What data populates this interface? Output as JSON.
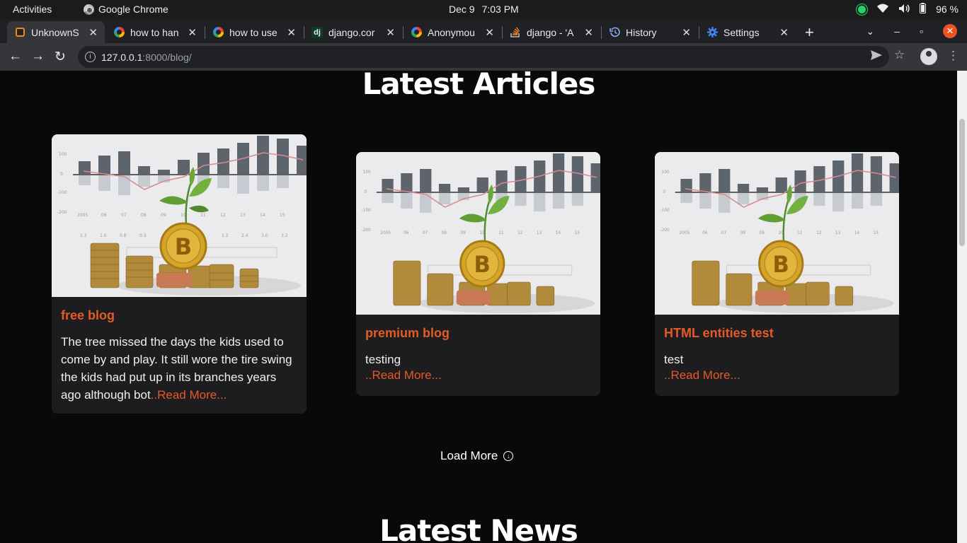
{
  "os": {
    "activities": "Activities",
    "app_name": "Google Chrome",
    "date": "Dec 9",
    "time": "7:03 PM",
    "battery": "96 %"
  },
  "tabs": [
    {
      "title": "UnknownS",
      "favicon": "site-icon",
      "active": true
    },
    {
      "title": "how to han",
      "favicon": "google-icon"
    },
    {
      "title": "how to use",
      "favicon": "google-icon"
    },
    {
      "title": "django.cor",
      "favicon": "django-icon"
    },
    {
      "title": "Anonymou",
      "favicon": "google-icon"
    },
    {
      "title": "django - 'A",
      "favicon": "stackoverflow-icon"
    },
    {
      "title": "History",
      "favicon": "history-icon"
    },
    {
      "title": "Settings",
      "favicon": "settings-icon"
    }
  ],
  "toolbar": {
    "url_host": "127.0.0.1",
    "url_rest": ":8000/blog/"
  },
  "page": {
    "section_title": "Latest Articles",
    "next_section_title": "Latest News",
    "load_more": "Load More",
    "articles": [
      {
        "title": "free blog",
        "text": "The tree missed the days the kids used to come by and play. It still wore the tire swing the kids had put up in its branches years ago although bot",
        "read_more": "..Read More..."
      },
      {
        "title": "premium blog",
        "text": "testing",
        "read_more": "..Read More..."
      },
      {
        "title": "HTML entities test",
        "text": "test",
        "read_more": "..Read More..."
      }
    ]
  },
  "colors": {
    "accent": "#e55a26",
    "card_bg": "#1d1d1f",
    "page_bg": "#090909"
  }
}
